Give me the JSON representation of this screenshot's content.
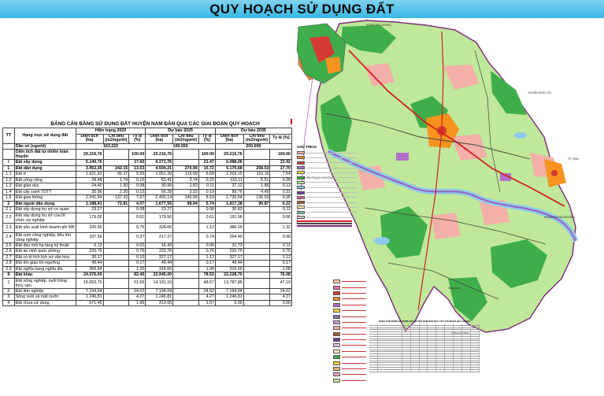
{
  "header": {
    "title": "QUY HOẠCH SỬ DỤNG ĐẤT"
  },
  "table": {
    "title": "BẢNG CÂN BẰNG SỬ DỤNG ĐẤT HUYỆN NAM ĐÀN QUA CÁC GIAI ĐOẠN QUY HOẠCH",
    "headers": {
      "tt": "TT",
      "item": "Hạng mục sử dụng đất",
      "period_2020": "Hiện trạng 2020",
      "period_2025": "Dự báo 2025",
      "period_2035": "Dự báo 2035",
      "area": "Diện tích (ha)",
      "norm": "Chỉ tiêu (m2/người)",
      "ratio": "Tỷ lệ (%)"
    },
    "rows": [
      {
        "tt": "",
        "name": "Dân số (người)",
        "bold": true,
        "pop_2020": "163.222",
        "pop_2025": "169.550",
        "pop_2035": "200.000"
      },
      {
        "tt": "",
        "name": "Diện tích đất tự nhiên toàn Huyện",
        "bold": true,
        "c": [
          "29.216,76",
          "",
          "100.00",
          "29.216,76",
          "",
          "100.00",
          "29.216,76",
          "",
          "100.00"
        ]
      },
      {
        "tt": "I",
        "name": "Đất xây dựng",
        "bold": true,
        "c": [
          "5.140,76",
          "",
          "17.60",
          "6.271,76",
          "",
          "21.47",
          "6.988,06",
          "",
          "23.92"
        ]
      },
      {
        "tt": "1",
        "name": "Đất dân dụng",
        "bold": true,
        "c": [
          "3.952,35",
          "242.15",
          "13.53",
          "4.594,21",
          "270.96",
          "15.72",
          "5.170,68",
          "258.53",
          "17.70"
        ]
      },
      {
        "tt": "1.1",
        "name": "Đất ở",
        "c": [
          "1.621,92",
          "99.37",
          "5.55",
          "1.951,39",
          "115.09",
          "6.68",
          "2.203,15",
          "110.16",
          "7.54"
        ]
      },
      {
        "tt": "1.2",
        "name": "Đất công cộng",
        "c": [
          "28.48",
          "1.74",
          "0.10",
          "63.41",
          "3.74",
          "0.22",
          "110.11",
          "5.51",
          "0.38"
        ]
      },
      {
        "tt": "1.3",
        "name": "Đất giáo dục",
        "c": [
          "24.40",
          "1.50",
          "0.08",
          "30.99",
          "1.83",
          "0.11",
          "37.12",
          "1.86",
          "0.13"
        ]
      },
      {
        "tt": "1.4",
        "name": "Đất cây xanh TDTT",
        "c": [
          "35.96",
          "2.20",
          "0.12",
          "56.28",
          "3.32",
          "0.19",
          "89.76",
          "4.49",
          "0.31"
        ]
      },
      {
        "tt": "1.5",
        "name": "Đất giao thông",
        "c": [
          "2.241,54",
          "137.33",
          "7.67",
          "2.492,14",
          "146.99",
          "8.53",
          "2.730,54",
          "136.53",
          "9.35"
        ]
      },
      {
        "tt": "2",
        "name": "Đất ngoài dân dụng",
        "bold": true,
        "c": [
          "1.188,41",
          "72.81",
          "4.07",
          "1.677,55",
          "98.94",
          "5.74",
          "1.817,38",
          "90.87",
          "6.22"
        ]
      },
      {
        "tt": "2.1",
        "name": "Đất xây dựng trụ sở cơ quan",
        "c": [
          "23.27",
          "",
          "0.08",
          "23.27",
          "",
          "0.08",
          "30.83",
          "",
          "0.11"
        ]
      },
      {
        "tt": "2.2",
        "name": "Đất xây dựng trụ sở của tổ chức sự nghiệp",
        "tall": true,
        "c": [
          "179.56",
          "",
          "0.61",
          "179.56",
          "",
          "0.61",
          "191.96",
          "",
          "0.66"
        ]
      },
      {
        "tt": "2.3",
        "name": "Đất sản xuất kinh doanh phi NN",
        "tall": true,
        "c": [
          "220.56",
          "",
          "0.75",
          "328.65",
          "",
          "1.12",
          "386.09",
          "",
          "1.32"
        ]
      },
      {
        "tt": "2.4",
        "name": "Đất cụm công nghiệp, tiểu thủ công nghiệp",
        "tall": true,
        "c": [
          "107.58",
          "",
          "0.37",
          "217.27",
          "",
          "0.74",
          "264.40",
          "",
          "0.90"
        ]
      },
      {
        "tt": "2.5",
        "name": "Đất đầu mối hạ tầng kỹ thuật",
        "c": [
          "6.13",
          "",
          "0.02",
          "16.43",
          "",
          "0.06",
          "31.73",
          "",
          "0.11"
        ]
      },
      {
        "tt": "2.6",
        "name": "Đất an ninh quốc phòng",
        "c": [
          "220.76",
          "",
          "0.76",
          "220.76",
          "",
          "0.76",
          "220.76",
          "",
          "0.76"
        ]
      },
      {
        "tt": "2.7",
        "name": "Đất có di tích lịch sử văn hóa",
        "c": [
          "30.17",
          "",
          "0.10",
          "327.17",
          "",
          "1.12",
          "327.17",
          "",
          "1.12"
        ]
      },
      {
        "tt": "2.8",
        "name": "Đất tôn giáo tín ngưỡng",
        "c": [
          "49.44",
          "",
          "0.17",
          "49.44",
          "",
          "0.17",
          "49.44",
          "",
          "0.17"
        ]
      },
      {
        "tt": "2.9",
        "name": "Đất nghĩa trang nghĩa địa",
        "c": [
          "350.94",
          "",
          "1.20",
          "315.00",
          "",
          "1.08",
          "315.00",
          "",
          "1.08"
        ]
      },
      {
        "tt": "II",
        "name": "Đất khác",
        "bold": true,
        "c": [
          "24.076,00",
          "",
          "82.40",
          "22.945,00",
          "",
          "78.53",
          "22.228,70",
          "",
          "76.08"
        ]
      },
      {
        "tt": "1",
        "name": "Đất nông nghiệp, nuôi trồng thủy sản",
        "tall": true,
        "c": [
          "15.063,70",
          "",
          "51.56",
          "14.191,10",
          "",
          "48.57",
          "13.787,85",
          "",
          "47.19"
        ]
      },
      {
        "tt": "2",
        "name": "Đất lâm nghiệp",
        "c": [
          "7.194,04",
          "",
          "24.62",
          "7.194,04",
          "",
          "24.62",
          "7.194,04",
          "",
          "24.62"
        ]
      },
      {
        "tt": "3",
        "name": "Sông suối và mặt nước",
        "c": [
          "1.246,81",
          "",
          "4.27",
          "1.246,81",
          "",
          "4.27",
          "1.246,81",
          "",
          "4.27"
        ]
      },
      {
        "tt": "4",
        "name": "Đất chưa sử dụng",
        "c": [
          "571.45",
          "",
          "1.96",
          "313.05",
          "",
          "1.07",
          "0.00",
          "",
          "0.00"
        ]
      }
    ]
  },
  "map": {
    "legend_title": "CHÚ THÍCH",
    "place_labels": [
      "HUYỆN ĐÔ LƯƠNG",
      "HUYỆN NGHI LỘC",
      "HUYỆN HƯNG NGUYÊN",
      "TP. VINH",
      "HUYỆN THANH CHƯƠNG",
      "TỈNH HÀ TĨNH",
      "Sông Lam"
    ],
    "colors": {
      "forest": "#3fae4a",
      "agriculture": "#bfe89a",
      "residential": "#f2b0a8",
      "water": "#8ec9ec",
      "river": "#9a5fb7",
      "commercial": "#d43a2f",
      "industrial": "#b06fc8",
      "urban": "#f7931e",
      "road_major": "#d22020",
      "road_minor": "#444444",
      "boundary": "#7a2a7a"
    },
    "legend_items": [
      {
        "color": "#f2b0a8",
        "icon": "residential-swatch"
      },
      {
        "color": "#f7931e",
        "icon": "urban-swatch"
      },
      {
        "color": "#d43a2f",
        "icon": "commercial-swatch"
      },
      {
        "color": "#b06fc8",
        "icon": "industrial-swatch"
      },
      {
        "color": "#ffd23f",
        "icon": "public-swatch"
      },
      {
        "color": "#3fae4a",
        "icon": "forest-swatch"
      },
      {
        "color": "#bfe89a",
        "icon": "agriculture-swatch"
      },
      {
        "color": "#8ec9ec",
        "icon": "water-swatch"
      },
      {
        "color": "#6b3fa0",
        "icon": "river-swatch"
      },
      {
        "color": "#e46ca8",
        "icon": "culture-swatch"
      },
      {
        "color": "#a0522d",
        "icon": "cemetery-swatch"
      },
      {
        "color": "#ffe9b3",
        "icon": "tourism-swatch"
      },
      {
        "color": "#7cc4a4",
        "icon": "park-swatch"
      },
      {
        "color": "#c7c7c7",
        "icon": "infrastructure-swatch"
      }
    ],
    "legend2_items": [
      {
        "color": "#f7c8a6"
      },
      {
        "color": "#e46ca8"
      },
      {
        "color": "#d43a2f"
      },
      {
        "color": "#f28b30"
      },
      {
        "color": "#b06fc8"
      },
      {
        "color": "#ffd23f"
      },
      {
        "color": "#8c6bb1"
      },
      {
        "color": "#c59bd8"
      },
      {
        "color": "#f2b0a8"
      },
      {
        "color": "#a05a2c"
      },
      {
        "color": "#6b3fa0"
      },
      {
        "color": "#e7c0e8"
      },
      {
        "color": "#ffe9b3"
      },
      {
        "color": "#3fae4a"
      },
      {
        "color": "#ffd23f"
      },
      {
        "color": "#d8b36a"
      },
      {
        "color": "#f0a0c0"
      },
      {
        "color": "#bfe89a"
      }
    ]
  }
}
